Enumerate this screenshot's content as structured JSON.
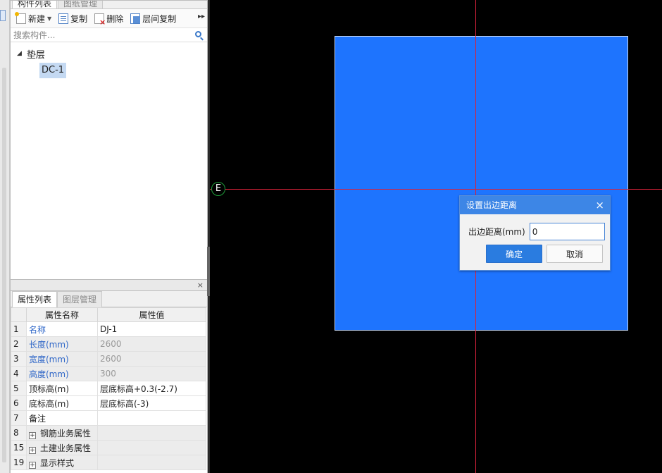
{
  "component_panel": {
    "tabs": [
      {
        "label": "构件列表"
      },
      {
        "label": "图纸管理"
      }
    ],
    "toolbar": {
      "new_label": "新建",
      "copy_label": "复制",
      "delete_label": "删除",
      "floor_copy_label": "层间复制",
      "more_label": "▸▸"
    },
    "search": {
      "placeholder": "搜索构件..."
    },
    "tree": {
      "category": "垫层",
      "item": "DC-1"
    }
  },
  "properties_panel": {
    "tabs": [
      {
        "label": "属性列表"
      },
      {
        "label": "图层管理"
      }
    ],
    "columns": {
      "name": "属性名称",
      "value": "属性值"
    },
    "rows": [
      {
        "num": "1",
        "name": "名称",
        "value": "DJ-1"
      },
      {
        "num": "2",
        "name": "长度(mm)",
        "value": "2600"
      },
      {
        "num": "3",
        "name": "宽度(mm)",
        "value": "2600"
      },
      {
        "num": "4",
        "name": "高度(mm)",
        "value": "300"
      },
      {
        "num": "5",
        "name": "顶标高(m)",
        "value": "层底标高+0.3(-2.7)"
      },
      {
        "num": "6",
        "name": "底标高(m)",
        "value": "层底标高(-3)"
      },
      {
        "num": "7",
        "name": "备注",
        "value": ""
      },
      {
        "num": "8",
        "name": "钢筋业务属性",
        "value": ""
      },
      {
        "num": "15",
        "name": "土建业务属性",
        "value": ""
      },
      {
        "num": "19",
        "name": "显示样式",
        "value": ""
      }
    ]
  },
  "canvas": {
    "axis_label": "E",
    "fill_color": "#1e74fe",
    "axis_color": "#d8223a"
  },
  "dialog": {
    "title": "设置出边距离",
    "field_label": "出边距离(mm)",
    "field_value": "0",
    "ok_label": "确定",
    "cancel_label": "取消",
    "close_label": "×"
  }
}
